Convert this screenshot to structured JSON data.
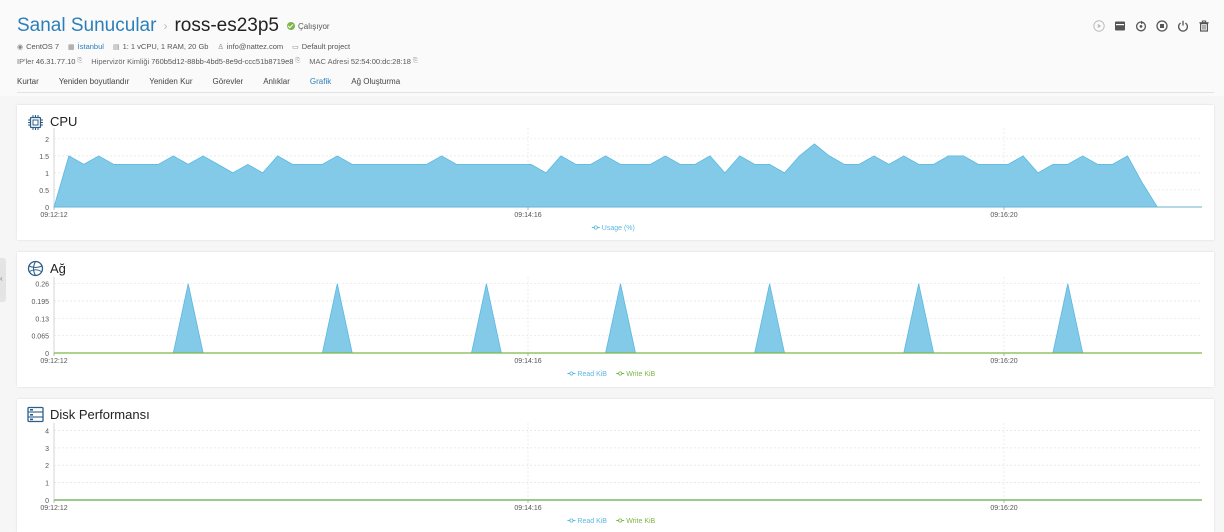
{
  "header": {
    "breadcrumb_root": "Sanal Sunucular",
    "separator": "›",
    "server_name": "ross-es23p5",
    "status": "Çalışıyor",
    "os": "CentOS 7",
    "location": "İstanbul",
    "plan": "1: 1 vCPU, 1 RAM, 20 Gb",
    "email": "info@nattez.com",
    "project": "Default project",
    "ip_label": "IP'ler",
    "ip_value": "46.31.77.10",
    "hypervisor_label": "Hipervizör Kimliği",
    "hypervisor_value": "760b5d12-88bb-4bd5-8e9d-ccc51b8719e8",
    "mac_label": "MAC Adresi",
    "mac_value": "52:54:00:dc:28:18",
    "copy_icon": "⎘"
  },
  "tabs": [
    {
      "label": "Kurtar"
    },
    {
      "label": "Yeniden boyutlandır"
    },
    {
      "label": "Yeniden Kur"
    },
    {
      "label": "Görevler"
    },
    {
      "label": "Anlıklar"
    },
    {
      "label": "Grafik",
      "active": true
    },
    {
      "label": "Ağ Oluşturma"
    }
  ],
  "sidebar_toggle": "‹",
  "colors": {
    "brand": "#2c7fb8",
    "area_fill": "#7cc7e8",
    "area_stroke": "#5bb8e0",
    "write_line": "#7ab648",
    "running": "#7ab648"
  },
  "panels": {
    "cpu": {
      "title": "CPU"
    },
    "network": {
      "title": "Ağ"
    },
    "disk": {
      "title": "Disk Performansı"
    }
  },
  "chart_data": [
    {
      "type": "area",
      "title": "CPU",
      "x_ticks": [
        "09:12:12",
        "09:14:16",
        "09:16:20"
      ],
      "y_ticks": [
        "0",
        "0.5",
        "1",
        "1.5",
        "2"
      ],
      "ylim": [
        0,
        2.2
      ],
      "legend": "bottom-center",
      "grid": true,
      "series": [
        {
          "name": "Usage (%)",
          "color": "#5bb8e0",
          "values": [
            0,
            1.5,
            1.25,
            1.5,
            1.25,
            1.25,
            1.25,
            1.25,
            1.5,
            1.25,
            1.5,
            1.25,
            1.0,
            1.25,
            1.0,
            1.5,
            1.25,
            1.25,
            1.25,
            1.5,
            1.25,
            1.25,
            1.25,
            1.25,
            1.25,
            1.25,
            1.5,
            1.25,
            1.25,
            1.25,
            1.25,
            1.25,
            1.25,
            1.0,
            1.5,
            1.25,
            1.25,
            1.5,
            1.25,
            1.25,
            1.25,
            1.5,
            1.25,
            1.25,
            1.5,
            1.0,
            1.5,
            1.25,
            1.25,
            1.0,
            1.5,
            1.85,
            1.5,
            1.25,
            1.25,
            1.5,
            1.25,
            1.5,
            1.25,
            1.25,
            1.5,
            1.5,
            1.25,
            1.25,
            1.25,
            1.5,
            1.0,
            1.25,
            1.25,
            1.5,
            1.25,
            1.25,
            1.5,
            0.7,
            0,
            0,
            0,
            0
          ]
        }
      ]
    },
    {
      "type": "area",
      "title": "Ağ",
      "x_ticks": [
        "09:12:12",
        "09:14:16",
        "09:16:20"
      ],
      "y_ticks": [
        "0",
        "0.065",
        "0.13",
        "0.195",
        "0.26"
      ],
      "ylim": [
        0,
        0.27
      ],
      "legend": "bottom-center",
      "grid": true,
      "series": [
        {
          "name": "Read KiB",
          "color": "#5bb8e0",
          "values": [
            0,
            0,
            0,
            0,
            0,
            0,
            0,
            0,
            0,
            0,
            0,
            0,
            0,
            0,
            0,
            0,
            0,
            0,
            0,
            0,
            0,
            0,
            0,
            0,
            0,
            0,
            0,
            0,
            0,
            0,
            0,
            0,
            0,
            0,
            0,
            0,
            0,
            0,
            0,
            0,
            0,
            0,
            0,
            0,
            0,
            0,
            0,
            0,
            0,
            0,
            0,
            0,
            0,
            0,
            0,
            0,
            0,
            0,
            0,
            0,
            0,
            0,
            0,
            0,
            0,
            0,
            0,
            0,
            0,
            0,
            0,
            0,
            0,
            0,
            0,
            0,
            0,
            0
          ],
          "peaks": [
            9,
            19,
            29,
            38,
            48,
            58,
            68
          ],
          "peak_value": 0.26
        },
        {
          "name": "Write KiB",
          "color": "#7ab648",
          "values": [
            0,
            0,
            0,
            0,
            0,
            0,
            0,
            0,
            0,
            0,
            0,
            0,
            0,
            0,
            0,
            0,
            0,
            0,
            0,
            0,
            0,
            0,
            0,
            0,
            0,
            0,
            0,
            0,
            0,
            0,
            0,
            0,
            0,
            0,
            0,
            0,
            0,
            0,
            0,
            0,
            0,
            0,
            0,
            0,
            0,
            0,
            0,
            0,
            0,
            0,
            0,
            0,
            0,
            0,
            0,
            0,
            0,
            0,
            0,
            0,
            0,
            0,
            0,
            0,
            0,
            0,
            0,
            0,
            0,
            0,
            0,
            0,
            0,
            0,
            0,
            0,
            0,
            0
          ]
        }
      ]
    },
    {
      "type": "line",
      "title": "Disk Performansı",
      "x_ticks": [
        "09:12:12",
        "09:14:16",
        "09:16:20"
      ],
      "y_ticks": [
        "0",
        "1",
        "2",
        "3",
        "4"
      ],
      "ylim": [
        0,
        4.2
      ],
      "legend": "bottom-center",
      "grid": true,
      "series": [
        {
          "name": "Read KiB",
          "color": "#5bb8e0",
          "values": [
            0,
            0,
            0,
            0,
            0,
            0,
            0,
            0,
            0,
            0,
            0,
            0,
            0,
            0,
            0,
            0,
            0,
            0,
            0,
            0,
            0,
            0,
            0,
            0,
            0,
            0,
            0,
            0,
            0,
            0,
            0,
            0,
            0,
            0,
            0,
            0,
            0,
            0,
            0,
            0,
            0,
            0,
            0,
            0,
            0,
            0,
            0,
            0,
            0,
            0,
            0,
            0,
            0,
            0,
            0,
            0,
            0,
            0,
            0,
            0,
            0,
            0,
            0,
            0,
            0,
            0,
            0,
            0,
            0,
            0,
            0,
            0,
            0,
            0,
            0,
            0,
            0,
            0
          ]
        },
        {
          "name": "Write KiB",
          "color": "#7ab648",
          "values": [
            0,
            0,
            0,
            0,
            0,
            0,
            0,
            0,
            0,
            0,
            0,
            0,
            0,
            0,
            0,
            0,
            0,
            0,
            0,
            0,
            0,
            0,
            0,
            0,
            0,
            0,
            0,
            0,
            0,
            0,
            0,
            0,
            0,
            0,
            0,
            0,
            0,
            0,
            0,
            0,
            0,
            0,
            0,
            0,
            0,
            0,
            0,
            0,
            0,
            0,
            0,
            0,
            0,
            0,
            0,
            0,
            0,
            0,
            0,
            0,
            0,
            0,
            0,
            0,
            0,
            0,
            0,
            0,
            0,
            0,
            0,
            0,
            0,
            0,
            0,
            0,
            0,
            0
          ]
        }
      ]
    }
  ]
}
